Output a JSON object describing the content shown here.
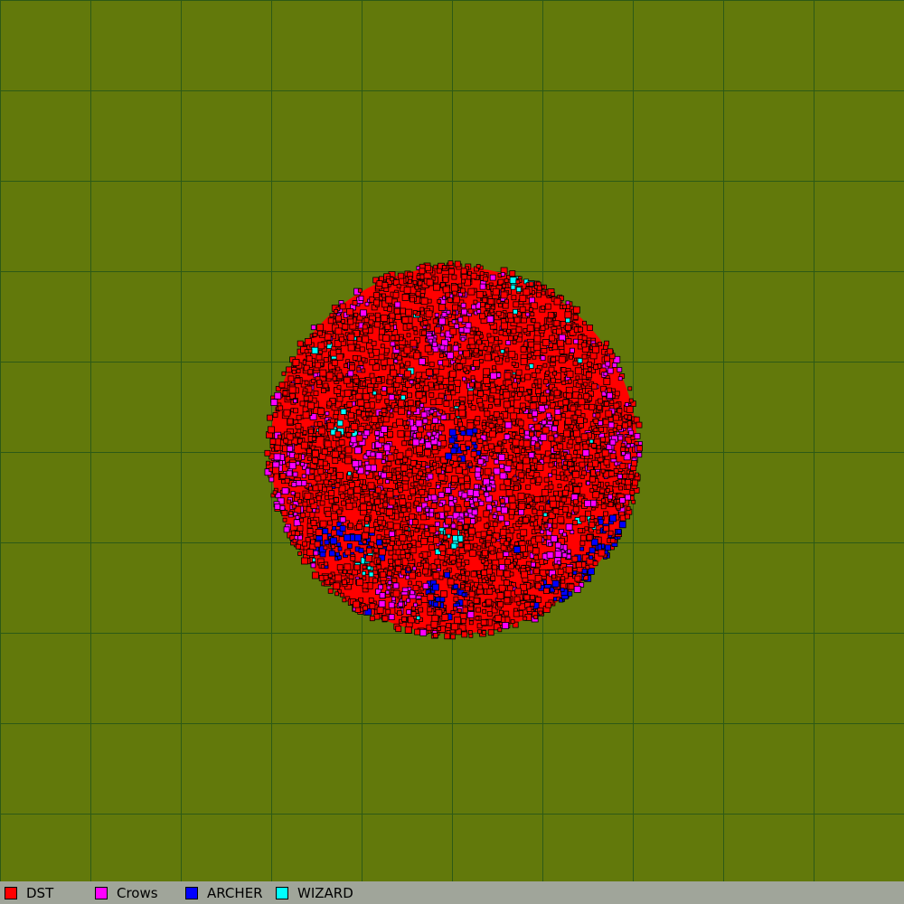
{
  "colors": {
    "terrain": "#62790b",
    "grid": "#2d5a16",
    "legend_bar": "#a0a59a",
    "outline": "#000000"
  },
  "legend": [
    {
      "label": "DST",
      "color": "#ff0000"
    },
    {
      "label": "Crows",
      "color": "#ff00ff"
    },
    {
      "label": "ARCHER",
      "color": "#0000ff"
    },
    {
      "label": "WIZARD",
      "color": "#00ffff"
    }
  ]
}
